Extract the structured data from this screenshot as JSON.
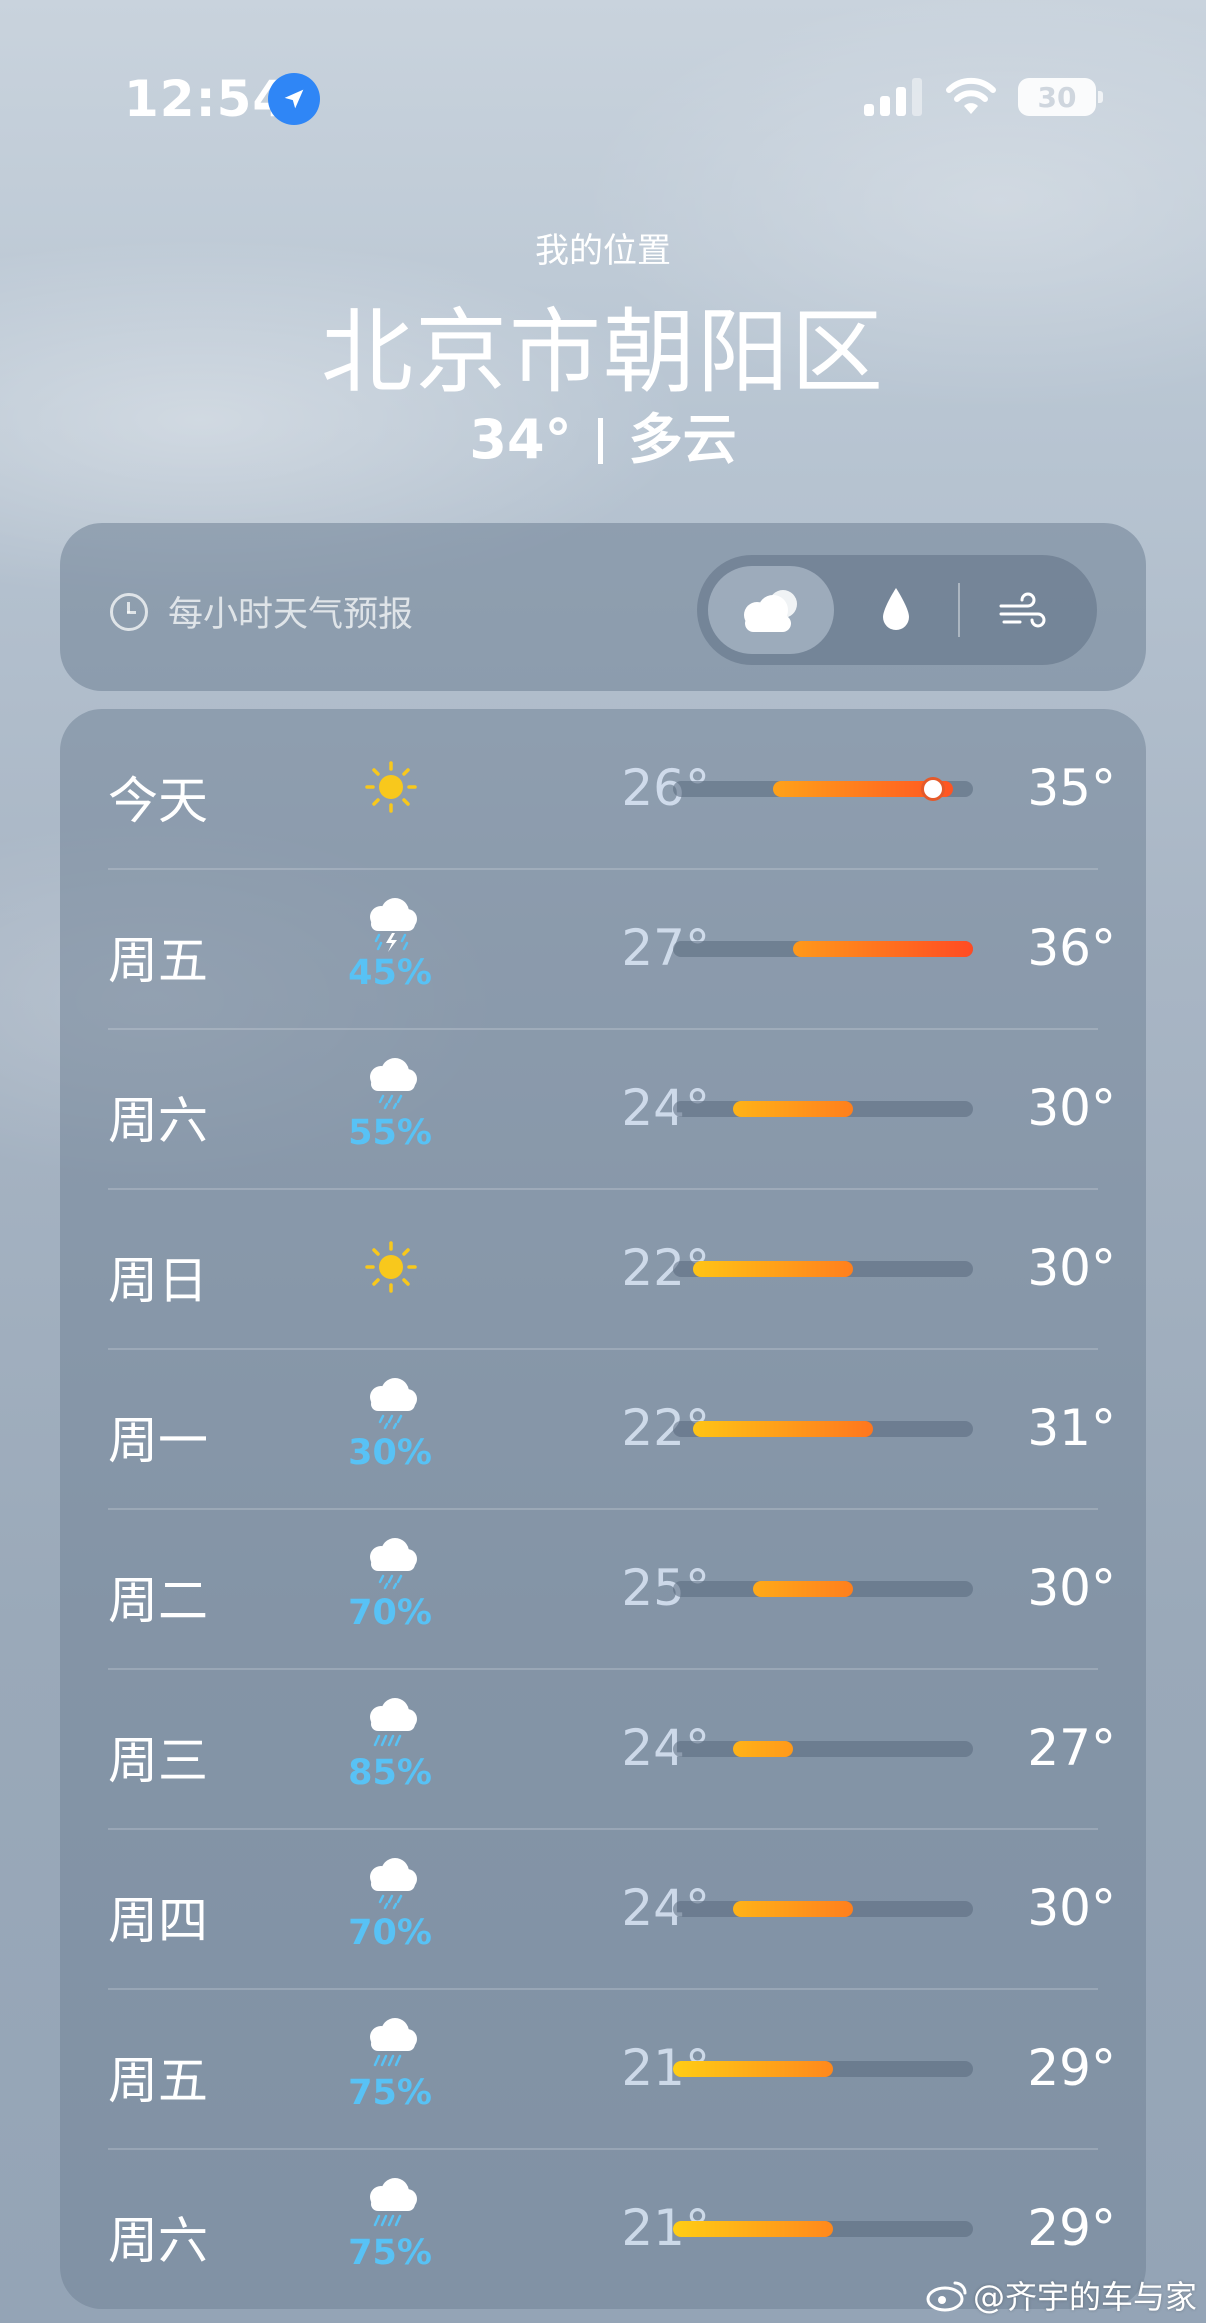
{
  "status_bar": {
    "time": "12:54",
    "battery": "30",
    "location_icon": "location-arrow-icon",
    "signal_icon": "cellular-signal-icon",
    "wifi_icon": "wifi-icon"
  },
  "header": {
    "my_location": "我的位置",
    "city": "北京市朝阳区",
    "current_temp": "34°",
    "current_condition": "多云"
  },
  "hourly": {
    "title": "每小时天气预报",
    "tabs": [
      {
        "icon": "cloud-icon",
        "selected": true
      },
      {
        "icon": "raindrop-icon",
        "selected": false
      },
      {
        "icon": "wind-icon",
        "selected": false
      }
    ]
  },
  "scale": {
    "min": 21,
    "max": 36
  },
  "daily": [
    {
      "day": "今天",
      "icon": "sun",
      "pop": "",
      "low": "26°",
      "high": "35°",
      "low_v": 26,
      "high_v": 35,
      "current_v": 34
    },
    {
      "day": "周五",
      "icon": "thunder",
      "pop": "45%",
      "low": "27°",
      "high": "36°",
      "low_v": 27,
      "high_v": 36
    },
    {
      "day": "周六",
      "icon": "rain",
      "pop": "55%",
      "low": "24°",
      "high": "30°",
      "low_v": 24,
      "high_v": 30
    },
    {
      "day": "周日",
      "icon": "sun",
      "pop": "",
      "low": "22°",
      "high": "30°",
      "low_v": 22,
      "high_v": 30
    },
    {
      "day": "周一",
      "icon": "rain",
      "pop": "30%",
      "low": "22°",
      "high": "31°",
      "low_v": 22,
      "high_v": 31
    },
    {
      "day": "周二",
      "icon": "rain",
      "pop": "70%",
      "low": "25°",
      "high": "30°",
      "low_v": 25,
      "high_v": 30
    },
    {
      "day": "周三",
      "icon": "heavy-rain",
      "pop": "85%",
      "low": "24°",
      "high": "27°",
      "low_v": 24,
      "high_v": 27
    },
    {
      "day": "周四",
      "icon": "rain",
      "pop": "70%",
      "low": "24°",
      "high": "30°",
      "low_v": 24,
      "high_v": 30
    },
    {
      "day": "周五",
      "icon": "heavy-rain",
      "pop": "75%",
      "low": "21°",
      "high": "29°",
      "low_v": 21,
      "high_v": 29
    },
    {
      "day": "周六",
      "icon": "heavy-rain",
      "pop": "75%",
      "low": "21°",
      "high": "29°",
      "low_v": 21,
      "high_v": 29
    }
  ],
  "watermark": "@齐宇的车与家"
}
